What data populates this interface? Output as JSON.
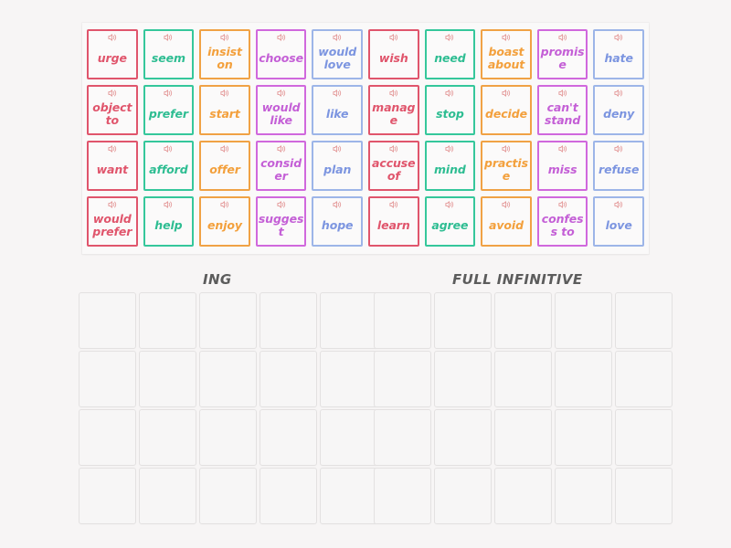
{
  "activity": {
    "type": "group-sort",
    "card_icon": "speaker-icon"
  },
  "word_bank": {
    "columns": 10,
    "rows": 4,
    "colors": [
      "#e0556c",
      "#35c79b",
      "#f0a245",
      "#d068dd",
      "#9db5e8"
    ],
    "cards": [
      "urge",
      "seem",
      "insist on",
      "choose",
      "would love",
      "wish",
      "need",
      "boast about",
      "promise",
      "hate",
      "object to",
      "prefer",
      "start",
      "would like",
      "like",
      "manage",
      "stop",
      "decide",
      "can't stand",
      "deny",
      "want",
      "afford",
      "offer",
      "consider",
      "plan",
      "accuse of",
      "mind",
      "practise",
      "miss",
      "refuse",
      "would prefer",
      "help",
      "enjoy",
      "suggest",
      "hope",
      "learn",
      "agree",
      "avoid",
      "confess to",
      "love"
    ]
  },
  "groups": [
    {
      "id": "ing",
      "heading": "ING",
      "slot_rows": 4,
      "slot_cols": 5
    },
    {
      "id": "infinitive",
      "heading": "FULL INFINITIVE",
      "slot_rows": 4,
      "slot_cols": 5
    }
  ]
}
